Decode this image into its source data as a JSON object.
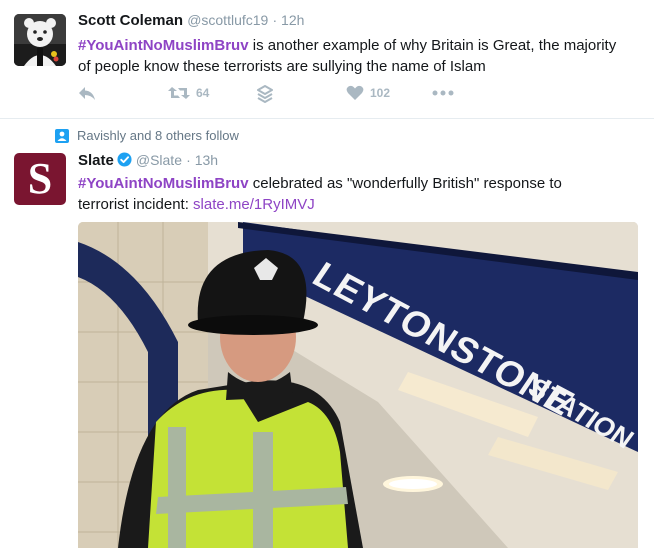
{
  "tweet1": {
    "name": "Scott Coleman",
    "handle": "@scottlufc19",
    "time": "· 12h",
    "hashtag": "#YouAintNoMuslimBruv",
    "text_line1": " is another example of why Britain is Great, the majority",
    "text_line2": "of people know these terrorists are sullying the name of Islam",
    "retweets": "64",
    "likes": "102",
    "icons": [
      "reply-icon",
      "retweet-icon",
      "stack-icon",
      "heart-icon",
      "more-icon"
    ]
  },
  "tweet2": {
    "context": "Ravishly and 8 others follow",
    "name": "Slate",
    "handle": "@Slate",
    "time": "· 13h",
    "hashtag": "#YouAintNoMuslimBruv",
    "text_line1": " celebrated as \"wonderfully British\" response to",
    "text_line2_plain": "terrorist incident: ",
    "link": "slate.me/1RyIMVJ",
    "avatar_letter": "S",
    "avatar_color": "#7a1530",
    "photo_sign_line1": "LEYTONSTONE",
    "photo_sign_line2": "STATION"
  },
  "colors": {
    "accent": "#8e44c5",
    "muted": "#aab8c2",
    "verified": "#1da1f2"
  }
}
